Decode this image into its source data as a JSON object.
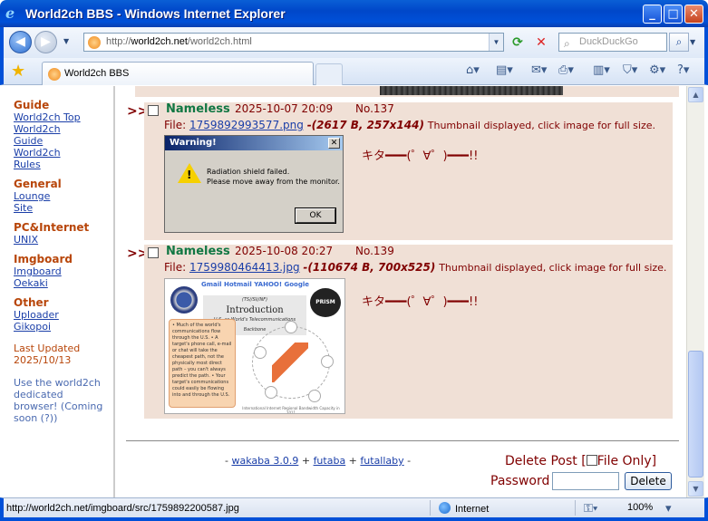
{
  "window": {
    "title": "World2ch BBS - Windows Internet Explorer"
  },
  "addressbar": {
    "url_prefix": "http://",
    "url_domain": "world2ch.net",
    "url_path": "/world2ch.html",
    "search_placeholder": "DuckDuckGo"
  },
  "tabs": [
    {
      "label": "World2ch BBS"
    }
  ],
  "sidebar": {
    "sections": [
      {
        "title": "Guide",
        "links": [
          "World2ch Top",
          "World2ch Guide",
          "World2ch Rules"
        ]
      },
      {
        "title": "General",
        "links": [
          "Lounge",
          "Site"
        ]
      },
      {
        "title": "PC&Internet",
        "links": [
          "UNIX"
        ]
      },
      {
        "title": "Imgboard",
        "links": [
          "Imgboard",
          "Oekaki"
        ]
      },
      {
        "title": "Other",
        "links": [
          "Uploader",
          "Gikopoi"
        ]
      }
    ],
    "updated_label": "Last Updated",
    "updated_date": "2025/10/13",
    "promo": "Use the world2ch dedicated browser! (Coming soon (?))"
  },
  "posts": [
    {
      "arrow": ">>",
      "name": "Nameless",
      "datetime": "2025-10-07 20:09",
      "number": "No.137",
      "file_label": "File:",
      "filename": "1759892993577.png",
      "file_meta": "-(2617 B, 257x144)",
      "hint": "Thumbnail displayed, click image for full size.",
      "body": "キタ━━━(゜∀゜)━━━!!",
      "thumb": {
        "title": "Warning!",
        "line1": "Radiation shield failed.",
        "line2": "Please move away from the monitor.",
        "ok": "OK"
      }
    },
    {
      "arrow": ">>",
      "name": "Nameless",
      "datetime": "2025-10-08 20:27",
      "number": "No.139",
      "file_label": "File:",
      "filename": "1759980464413.jpg",
      "file_meta": "-(110674 B, 700x525)",
      "hint": "Thumbnail displayed, click image for full size.",
      "body": "キタ━━━(゜∀゜)━━━!!",
      "thumb": {
        "logos": "Gmail Hotmail YAHOO! Google",
        "title_pre": "(TS//SI//NF)",
        "title": "Introduction",
        "subtitle": "U.S. as World's Telecommunications Backbone",
        "badge": "PRISM",
        "bullets": "• Much of the world's communications flow through the U.S. • A target's phone call, e-mail or chat will take the cheapest path, not the physically most direct path – you can't always predict the path. • Your target's communications could easily be flowing into and through the U.S.",
        "footer": "International Internet Regional Bandwidth Capacity in 2011"
      }
    }
  ],
  "footer": {
    "credits_prefix": "- ",
    "link1": "wakaba 3.0.9",
    "sep1": " + ",
    "link2": "futaba",
    "sep2": " + ",
    "link3": "futallaby",
    "credits_suffix": " -"
  },
  "deleteform": {
    "delete_post": "Delete Post [",
    "file_only": "File Only]",
    "password_label": "Password",
    "delete_button": "Delete"
  },
  "statusbar": {
    "url": "http://world2ch.net/imgboard/src/1759892200587.jpg",
    "zone": "Internet",
    "zoom": "100%"
  },
  "colors": {
    "post_bg": "#f0e0d6",
    "name": "#117743",
    "post_text": "#800000",
    "link": "#1a3ea8",
    "section_title": "#b8460a"
  }
}
